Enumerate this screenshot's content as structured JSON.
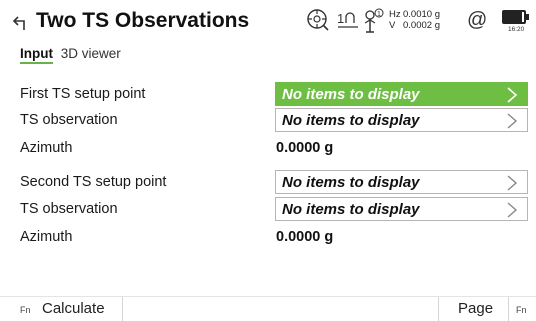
{
  "header": {
    "title": "Two TS Observations",
    "hz_label": "Hz",
    "hz_value": "0.0010 g",
    "v_label": "V",
    "v_value": "0.0002 g",
    "at_symbol": "@",
    "time": "16:20",
    "status_icons": [
      "back-arrow-icon",
      "target-icon",
      "one-face-icon",
      "prism-icon",
      "at-icon",
      "battery-icon"
    ]
  },
  "tabs": [
    {
      "label": "Input",
      "active": true
    },
    {
      "label": "3D viewer",
      "active": false
    }
  ],
  "form": {
    "rows": [
      {
        "label": "First TS setup point",
        "value": "No items to display",
        "kind": "picker",
        "active": true
      },
      {
        "label": "TS observation",
        "value": "No items to display",
        "kind": "picker",
        "active": false
      },
      {
        "label": "Azimuth",
        "value": "0.0000 g",
        "kind": "readonly"
      },
      {
        "label": "Second TS setup point",
        "value": "No items to display",
        "kind": "picker",
        "active": false
      },
      {
        "label": "TS observation",
        "value": "No items to display",
        "kind": "picker",
        "active": false
      },
      {
        "label": "Azimuth",
        "value": "0.0000 g",
        "kind": "readonly"
      }
    ]
  },
  "bottom_bar": {
    "fn_left": "Fn",
    "calculate_label": "Calculate",
    "page_label": "Page",
    "fn_right": "Fn"
  },
  "colors": {
    "accent": "#6fbe44",
    "tab_underline": "#6ab04c",
    "picker_border": "#b5b5b5"
  }
}
